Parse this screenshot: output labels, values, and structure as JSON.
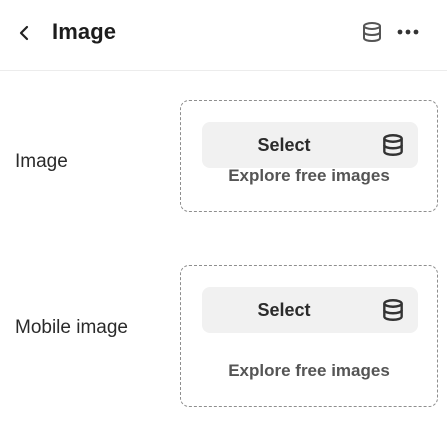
{
  "header": {
    "title": "Image",
    "icons": [
      "chevron-left-icon",
      "database-icon",
      "more-horizontal-icon"
    ]
  },
  "fields": [
    {
      "label": "Image",
      "select_label": "Select",
      "explore_label": "Explore free images",
      "icon": "database-icon"
    },
    {
      "label": "Mobile image",
      "select_label": "Select",
      "explore_label": "Explore free images",
      "icon": "database-icon"
    }
  ],
  "colors": {
    "select_bg": "#f1f1f1",
    "border": "#8e8e8e",
    "text": "#1f1f1f"
  }
}
